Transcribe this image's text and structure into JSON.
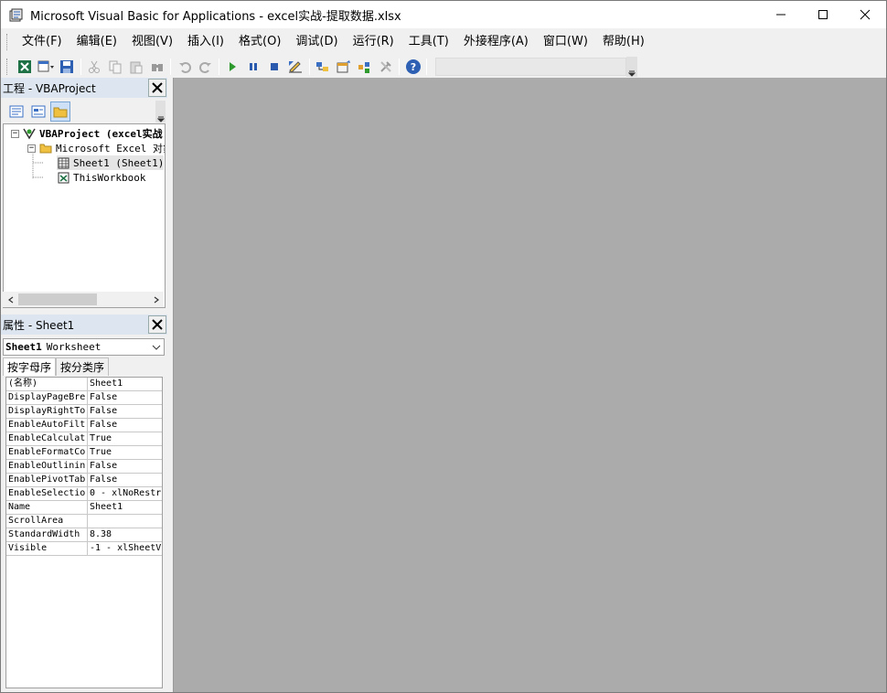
{
  "window": {
    "title": "Microsoft Visual Basic for Applications - excel实战-提取数据.xlsx"
  },
  "menu": [
    "文件(F)",
    "编辑(E)",
    "视图(V)",
    "插入(I)",
    "格式(O)",
    "调试(D)",
    "运行(R)",
    "工具(T)",
    "外接程序(A)",
    "窗口(W)",
    "帮助(H)"
  ],
  "toolbar": {
    "icons": [
      "excel-view-icon",
      "insert-userform-icon",
      "save-icon",
      "cut-icon",
      "copy-icon",
      "paste-icon",
      "find-icon",
      "undo-icon",
      "redo-icon",
      "run-icon",
      "break-icon",
      "reset-icon",
      "design-mode-icon",
      "project-explorer-icon",
      "properties-window-icon",
      "object-browser-icon",
      "toolbox-icon",
      "help-icon"
    ]
  },
  "project_panel": {
    "title": "工程 - VBAProject",
    "tree": {
      "root": "VBAProject (excel实战",
      "folder": "Microsoft Excel 对象",
      "items": [
        "Sheet1 (Sheet1)",
        "ThisWorkbook"
      ]
    }
  },
  "properties_panel": {
    "title": "属性 - Sheet1",
    "object_select": {
      "name": "Sheet1",
      "type": "Worksheet"
    },
    "tabs": [
      "按字母序",
      "按分类序"
    ],
    "rows": [
      [
        "(名称)",
        "Sheet1"
      ],
      [
        "DisplayPageBre",
        "False"
      ],
      [
        "DisplayRightTo",
        "False"
      ],
      [
        "EnableAutoFilt",
        "False"
      ],
      [
        "EnableCalculat",
        "True"
      ],
      [
        "EnableFormatCo",
        "True"
      ],
      [
        "EnableOutlinin",
        "False"
      ],
      [
        "EnablePivotTab",
        "False"
      ],
      [
        "EnableSelectio",
        "0 - xlNoRestr"
      ],
      [
        "Name",
        "Sheet1"
      ],
      [
        "ScrollArea",
        ""
      ],
      [
        "StandardWidth",
        "8.38"
      ],
      [
        "Visible",
        "-1 - xlSheetV"
      ]
    ]
  }
}
